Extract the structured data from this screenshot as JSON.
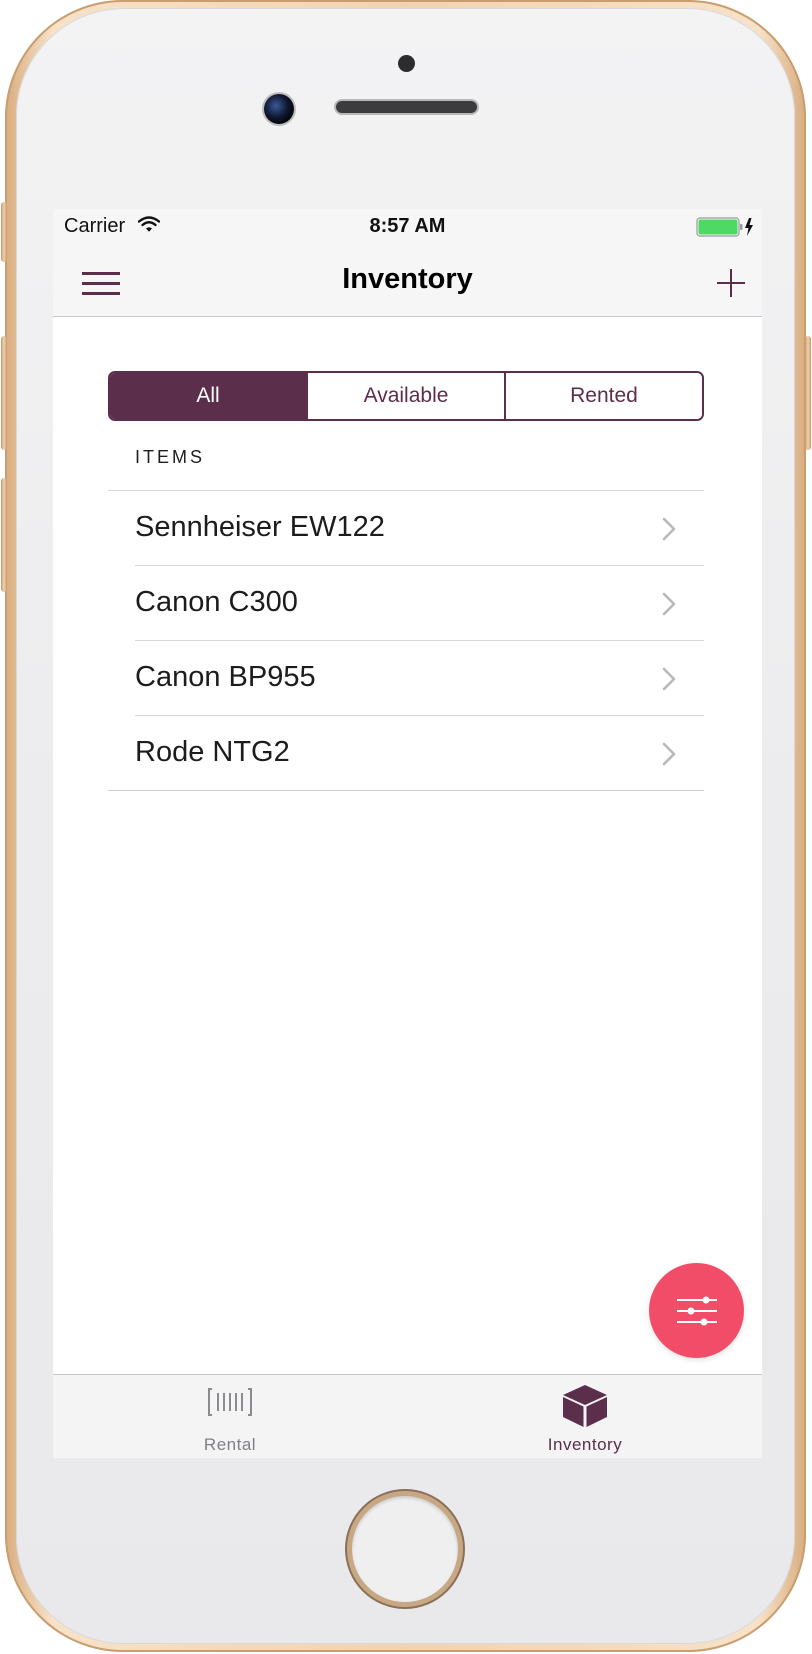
{
  "status_bar": {
    "carrier": "Carrier",
    "time": "8:57 AM",
    "icons": [
      "wifi-icon",
      "battery-icon",
      "charging-bolt-icon"
    ],
    "battery_color": "#4cd964"
  },
  "nav_bar": {
    "title": "Inventory",
    "left_icon": "hamburger-menu-icon",
    "right_icon": "plus-icon"
  },
  "filter": {
    "segments": [
      {
        "label": "All",
        "selected": true
      },
      {
        "label": "Available",
        "selected": false
      },
      {
        "label": "Rented",
        "selected": false
      }
    ]
  },
  "items_section": {
    "header": "ITEMS",
    "items": [
      {
        "label": "Sennheiser EW122"
      },
      {
        "label": "Canon C300"
      },
      {
        "label": "Canon BP955"
      },
      {
        "label": "Rode NTG2"
      }
    ]
  },
  "fab": {
    "icon": "filter-sliders-icon",
    "color": "#f24d68"
  },
  "tab_bar": {
    "tabs": [
      {
        "label": "Rental",
        "icon": "barcode-icon",
        "selected": false
      },
      {
        "label": "Inventory",
        "icon": "box-icon",
        "selected": true
      }
    ]
  },
  "theme": {
    "accent": "#5b2f4b",
    "device_frame": "gold"
  }
}
